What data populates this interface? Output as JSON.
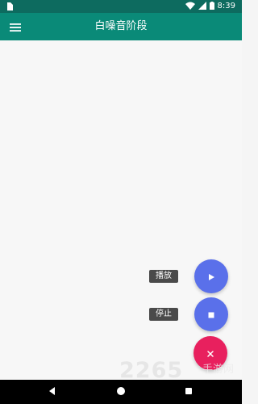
{
  "status_bar": {
    "time": "8:39",
    "left_icon": "sim-card-icon",
    "right_icons": [
      "wifi-icon",
      "cell-signal-icon",
      "battery-icon"
    ]
  },
  "app_bar": {
    "title": "白噪音阶段",
    "menu_icon": "menu-icon"
  },
  "fab_menu": {
    "play_label": "播放",
    "stop_label": "停止",
    "play_icon": "play-icon",
    "stop_icon": "stop-icon",
    "close_icon": "close-icon"
  },
  "navigation_bar": {
    "back_icon": "back-icon",
    "home_icon": "home-icon",
    "recents_icon": "recents-icon"
  },
  "watermark": {
    "number": "2265",
    "text": "手游网"
  },
  "colors": {
    "status_bar": "#0d6b5f",
    "app_bar": "#0a8a78",
    "content_bg": "#f7f7f7",
    "fab_blue": "#5a70ea",
    "fab_pink": "#e8205e",
    "label_bg": "#4a4a4a",
    "nav_bg": "#000000"
  }
}
